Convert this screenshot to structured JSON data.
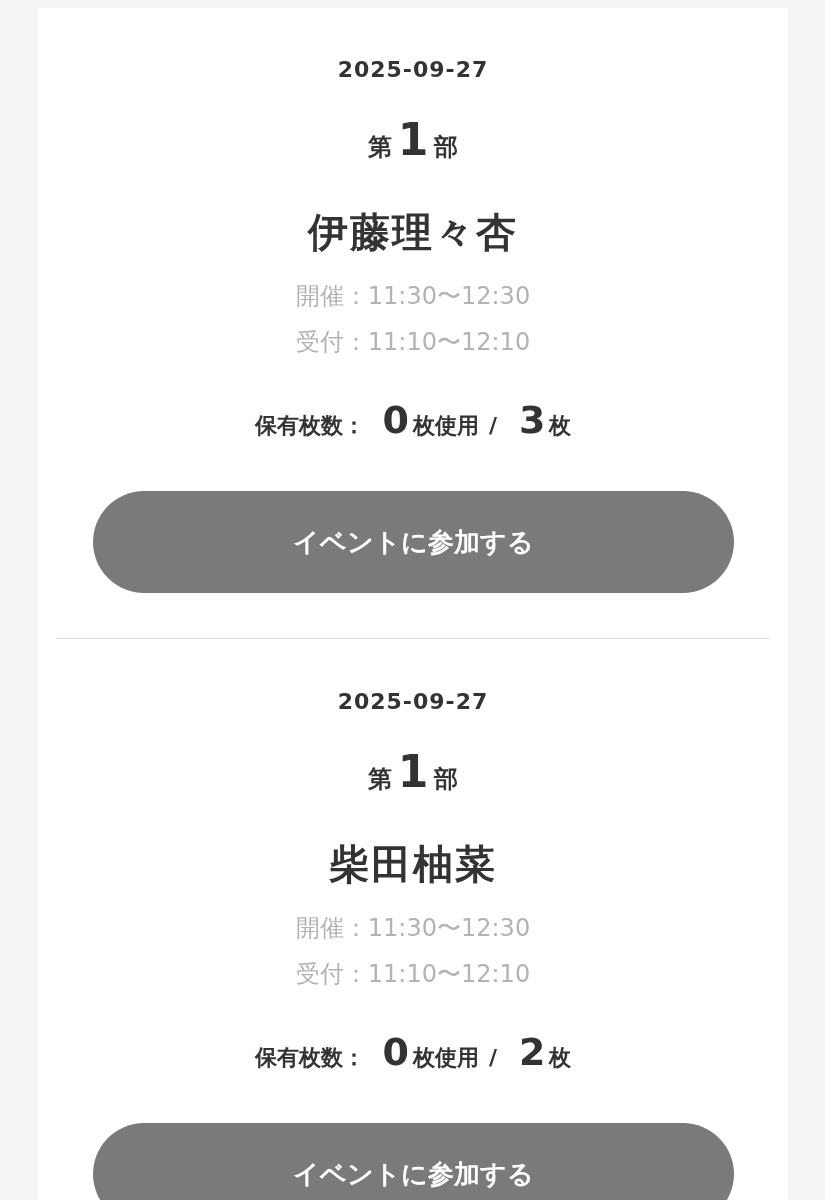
{
  "sessions": [
    {
      "date": "2025-09-27",
      "part": {
        "prefix": "第",
        "number": "1",
        "suffix": "部"
      },
      "name": "伊藤理々杏",
      "held": "開催：11:30〜12:30",
      "reception": "受付：11:10〜12:10",
      "tickets": {
        "label": "保有枚数：",
        "used": "0",
        "used_unit": "枚使用",
        "separator": "/",
        "total": "3",
        "total_unit": "枚"
      },
      "button": "イベントに参加する"
    },
    {
      "date": "2025-09-27",
      "part": {
        "prefix": "第",
        "number": "1",
        "suffix": "部"
      },
      "name": "柴田柚菜",
      "held": "開催：11:30〜12:30",
      "reception": "受付：11:10〜12:10",
      "tickets": {
        "label": "保有枚数：",
        "used": "0",
        "used_unit": "枚使用",
        "separator": "/",
        "total": "2",
        "total_unit": "枚"
      },
      "button": "イベントに参加する"
    }
  ]
}
